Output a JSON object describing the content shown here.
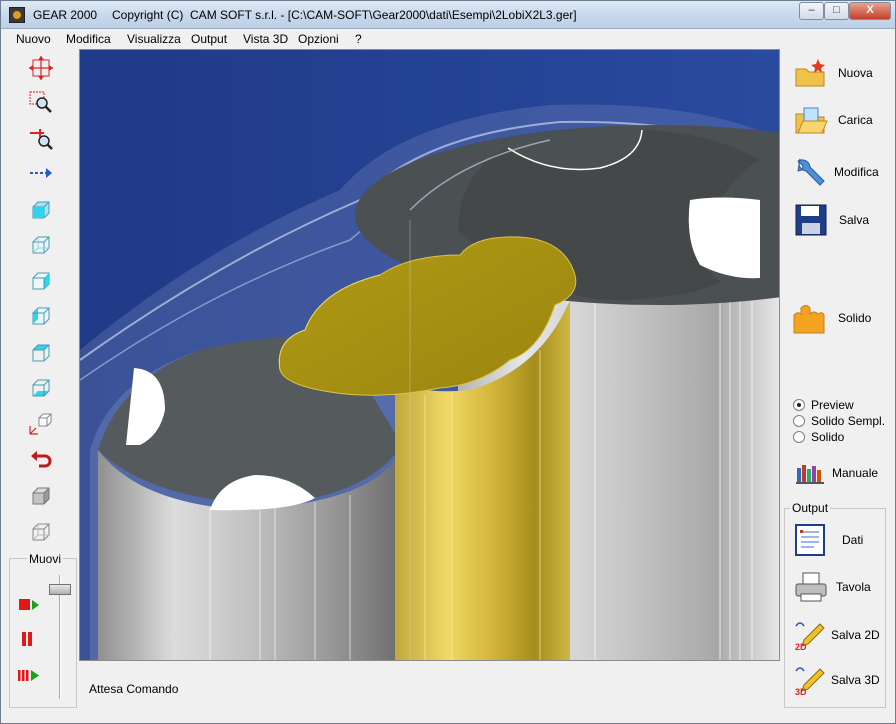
{
  "window": {
    "app_name": "GEAR 2000",
    "title_rest": "Copyright (C)  CAM SOFT s.r.l. - [C:\\CAM-SOFT\\Gear2000\\dati\\Esempi\\2LobiX2L3.ger]",
    "minimize": "–",
    "restore": "□",
    "close": "X"
  },
  "menu": [
    "Nuovo",
    "Modifica",
    "Visualizza",
    "Output",
    "Vista 3D",
    "Opzioni",
    "?"
  ],
  "left_toolbar": [
    "move-arrows-icon",
    "zoom-window-icon",
    "zoom-in-out-icon",
    "pan-arrow-icon",
    "view-front-cube-icon",
    "view-back-cube-icon",
    "view-left-cube-icon",
    "view-right-cube-icon",
    "view-top-cube-icon",
    "view-bottom-cube-icon",
    "view-axes-icon",
    "undo-view-icon",
    "shaded-cube-icon",
    "wire-cube-icon"
  ],
  "muovi": {
    "label": "Muovi",
    "play": "record-play-icon",
    "pause": "pause-icon",
    "step": "step-play-icon"
  },
  "status": {
    "text": "Attesa Comando"
  },
  "right_panel": {
    "nuova": "Nuova",
    "carica": "Carica",
    "modifica": "Modifica",
    "salva": "Salva",
    "solido": "Solido",
    "render_options": [
      {
        "label": "Preview",
        "checked": true
      },
      {
        "label": "Solido Sempl.",
        "checked": false
      },
      {
        "label": "Solido",
        "checked": false
      }
    ],
    "manuale": "Manuale"
  },
  "output": {
    "title": "Output",
    "dati": "Dati",
    "tavola": "Tavola",
    "salva2d": "Salva 2D",
    "salva3d": "Salva 3D"
  },
  "colors": {
    "viewport_bg": "#23438f",
    "rotor_gold": "#b8a21d",
    "body_grey": "#b9b9b9"
  }
}
